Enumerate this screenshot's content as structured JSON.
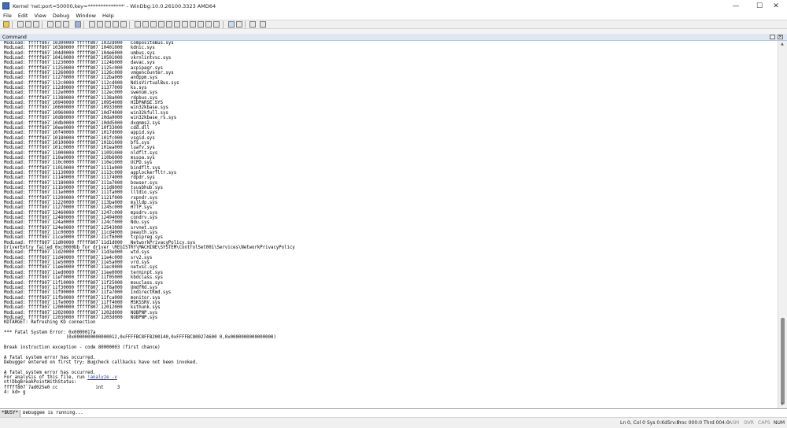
{
  "window": {
    "title": "Kernel 'net:port=50000,key=**************' - WinDbg:10.0.26100.3323 AMD64",
    "minimize_glyph": "—",
    "maximize_glyph": "☐",
    "close_glyph": "✕"
  },
  "menu": [
    "File",
    "Edit",
    "View",
    "Debug",
    "Window",
    "Help"
  ],
  "command_window": {
    "title": "Command",
    "output_lines_a": [
      "ModLoad: fffff807`10300000 fffff807`1032d000   CompositeBus.sys",
      "ModLoad: fffff807`10380000 fffff807`10401000   kdnic.sys",
      "ModLoad: fffff807`104d0000 fffff807`104e6000   umbus.sys",
      "ModLoad: fffff807`10410000 fffff807`10501000   vkrnlintvsc.sys",
      "ModLoad: fffff807`11230000 fffff807`1124b000   davac.sys",
      "ModLoad: fffff807`11250000 fffff807`1125c000   acpipagr.sys",
      "ModLoad: fffff807`11260000 fffff807`1126c000   vmgencounter.sys",
      "ModLoad: fffff807`11270000 fffff807`112ba000   andppm.sys",
      "ModLoad: fffff807`112c0000 fffff807`112cd000   NdisVirtualBus.sys",
      "ModLoad: fffff807`112d0000 fffff807`11377000   ks.sys",
      "ModLoad: fffff807`112e0000 fffff807`112ec000   swenum.sys",
      "ModLoad: fffff807`11380000 fffff807`1138a000   rdpbus.sys",
      "ModLoad: fffff807`10940000 fffff807`10954000   HIDPARSE.SYS",
      "ModLoad: fffff807`10600000 fffff807`10933000   win32kbase.sys",
      "ModLoad: fffff807`10960000 fffff807`10d74000   win32kfull.sys",
      "ModLoad: fffff807`10d80000 fffff807`10da9000   win32kbase_rs.sys",
      "ModLoad: fffff807`10db0000 fffff807`10dd5000   dxgmms2.sys",
      "ModLoad: fffff807`10ee0000 fffff807`10f33000   cdd.dll",
      "ModLoad: fffff807`10f40000 fffff807`1017d000   appid.sys",
      "ModLoad: fffff807`10180000 fffff807`101fc000   vsgid.sys",
      "ModLoad: fffff807`10190000 fffff807`101b1000   bfs.sys",
      "ModLoad: fffff807`101c0000 fffff807`101ea000   luafv.sys",
      "ModLoad: fffff807`11000000 fffff807`11091000   nldflt.sys",
      "ModLoad: fffff807`110a0000 fffff807`110b6000   mssoa.sys",
      "ModLoad: fffff807`110c0000 fffff807`110e1000   UCPD.sys",
      "ModLoad: fffff807`11010000 fffff807`1111e000   bindflt.sys",
      "ModLoad: fffff807`11130000 fffff807`1113c000   applockerfltr.sys",
      "ModLoad: fffff807`11140000 fffff807`11174000   rdpdr.sys",
      "ModLoad: fffff807`11180000 fffff807`111a7000   bowser.sys",
      "ModLoad: fffff807`111b0000 fffff807`111d8000   tsusbhub.sys",
      "ModLoad: fffff807`111e0000 fffff807`111fa000   lltdio.sys",
      "ModLoad: fffff807`11200000 fffff807`1121f000   rspndr.sys",
      "ModLoad: fffff807`11220000 fffff807`113ba000   mslldp.sys",
      "ModLoad: fffff807`11270000 fffff807`1245c000   HTTP.sys",
      "ModLoad: fffff807`12460000 fffff807`1247c000   mpsdrv.sys",
      "ModLoad: fffff807`12480000 fffff807`12494000   condrv.sys",
      "ModLoad: fffff807`124a0000 fffff807`124cf000   Ndu.sys",
      "ModLoad: fffff807`124e0000 fffff807`12543000   srvnet.sys",
      "ModLoad: fffff807`11c00000 fffff807`11cd4000   peauth.sys",
      "ModLoad: fffff807`11ce0000 fffff807`11cf6000   tcpipreg.sys",
      "ModLoad: fffff807`11d00000 fffff807`11d1d000   NetworkPrivacyPolicy.sys",
      "DriverEntry failed 0xc0000bb for driver \\REGISTRY\\MACHINE\\SYSTEM\\ControlSet001\\Services\\NetworkPrivacyPolicy",
      "ModLoad: fffff807`11d20000 fffff807`11d3e000   wtd.sys",
      "ModLoad: fffff807`11d40000 fffff807`11e4c000   srv2.sys",
      "ModLoad: fffff807`11e50000 fffff807`11e5a000   vrd.sys",
      "ModLoad: fffff807`11e60000 fffff807`11ec0000   netvsc.sys",
      "ModLoad: fffff807`11ed0000 fffff807`11ee0000   terminpt.sys",
      "ModLoad: fffff807`11ef0000 fffff807`11f05000   kbdclass.sys",
      "ModLoad: fffff807`11f10000 fffff807`11f25000   mouclass.sys",
      "ModLoad: fffff807`11f30000 fffff807`11f8a000   UmdfRd.sys",
      "ModLoad: fffff807`11f90000 fffff807`11fa7000   IndirectKmd.sys",
      "ModLoad: fffff807`11fb0000 fffff807`11fca000   monitor.sys",
      "ModLoad: fffff807`11fe0000 fffff807`11ff4000   MSKSSRV.sys",
      "ModLoad: fffff807`12000000 fffff807`12012000   ksthunk.sys",
      "ModLoad: fffff807`12020000 fffff807`1202d000   NOBPNP.sys",
      "ModLoad: fffff807`12030000 fffff807`1203d000   NOBPNP.sys",
      "KDTARGET: Refreshing KD connection",
      "",
      "*** Fatal System Error: 0x0000017a",
      "                       (0x0000000000000012,0xFFFFBC8FF8200140,0xFFFFBC800274600 0,0x0000000000000000)",
      "",
      "Break instruction exception - code 80000003 (first chance)",
      "",
      "A fatal system error has occurred.",
      "Debugger entered on first try; Bugcheck callbacks have not been invoked.",
      "",
      "A fatal system error has occurred.",
      ""
    ],
    "analysis_prefix": "For analysis of this file, run ",
    "analysis_link": "!analyze -v",
    "output_lines_b": [
      "nt!DbgBreakPointWithStatus:",
      "fffff807`7ad025e0 cc              int     3",
      "4: kd> g"
    ],
    "prompt": "*BUSY*",
    "input_value": "Debuggee is running..."
  },
  "status_bar": {
    "ln_col": "Ln 0, Col 0",
    "sys": "Sys 0:KdSrv:S",
    "proc": "Proc 000:0",
    "thrd": "Thrd 004:0",
    "asm": "ASM",
    "ovr": "OVR",
    "caps": "CAPS",
    "num": "NUM"
  }
}
